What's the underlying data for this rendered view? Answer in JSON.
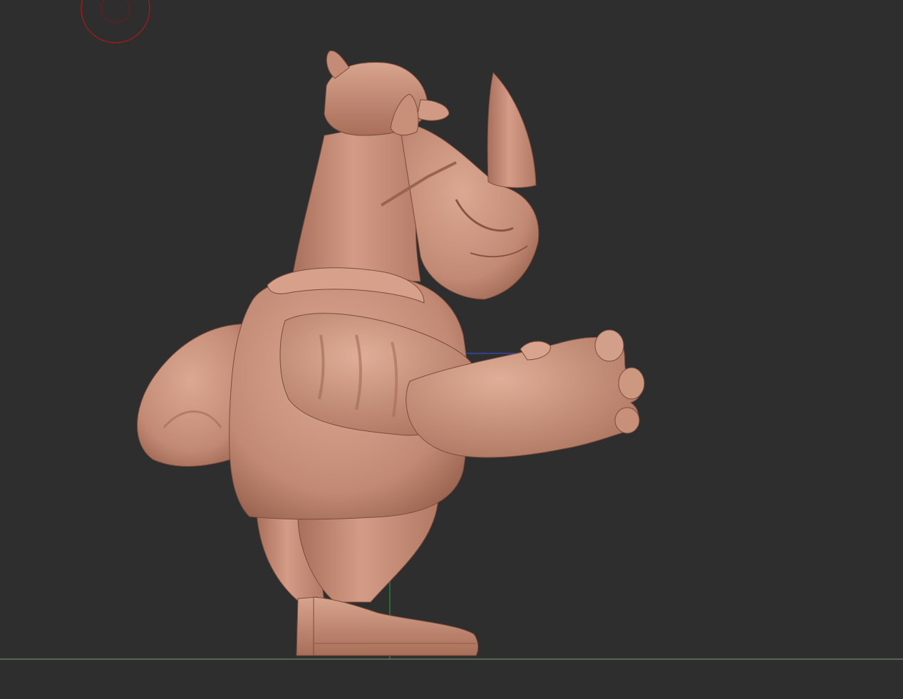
{
  "viewport": {
    "background_color": "#2e2e2e",
    "model_color": "#c9907a",
    "model_shadow_color": "#8e5e4c",
    "model_highlight_color": "#e2b4a0",
    "gizmo_color": "#b01818",
    "ground_line_color": "#7fa07a",
    "y_axis_color": "#2ea040",
    "z_axis_color": "#2e3ea0"
  },
  "scene": {
    "subject_icon": "rhino-character-sculpt"
  }
}
